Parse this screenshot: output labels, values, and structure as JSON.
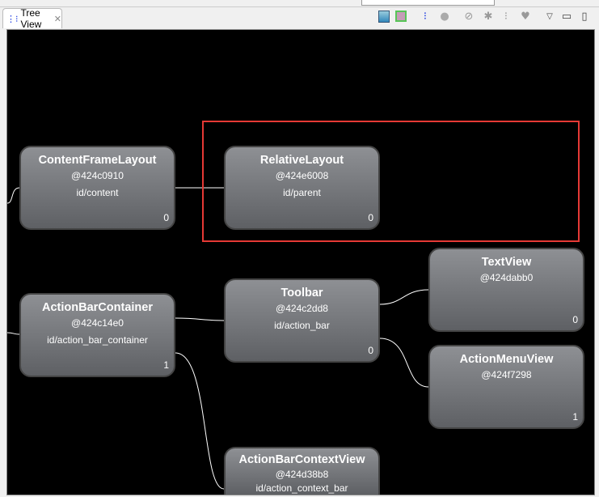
{
  "tab": {
    "icon": "tree-view-icon",
    "label": "Tree View",
    "close": "close-icon"
  },
  "toolbar": [
    "save-icon",
    "overlay-icon",
    "load-hierarchy-icon",
    "display-view-icon",
    "invalidate-icon",
    "request-layout-icon",
    "dump-tree-icon",
    "profile-icon",
    "view-menu-icon",
    "minimize-icon",
    "maximize-icon"
  ],
  "nodes": [
    {
      "name": "ContentFrameLayout",
      "hash": "@424c0910",
      "id": "id/content",
      "count": "0"
    },
    {
      "name": "RelativeLayout",
      "hash": "@424e6008",
      "id": "id/parent",
      "count": "0"
    },
    {
      "name": "ActionBarContainer",
      "hash": "@424c14e0",
      "id": "id/action_bar_container",
      "count": "1"
    },
    {
      "name": "Toolbar",
      "hash": "@424c2dd8",
      "id": "id/action_bar",
      "count": "0"
    },
    {
      "name": "TextView",
      "hash": "@424dabb0",
      "id": "",
      "count": "0"
    },
    {
      "name": "ActionMenuView",
      "hash": "@424f7298",
      "id": "",
      "count": "1"
    },
    {
      "name": "ActionBarContextView",
      "hash": "@424d38b8",
      "id": "id/action_context_bar",
      "count": ""
    }
  ],
  "colors": {
    "highlight": "#e53935",
    "canvas": "#000000"
  }
}
